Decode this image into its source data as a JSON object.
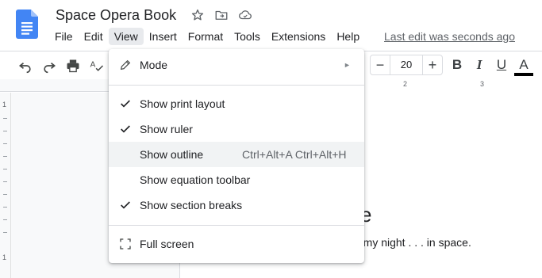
{
  "document": {
    "title": "Space Opera Book",
    "last_edit": "Last edit was seconds ago"
  },
  "menubar": {
    "items": [
      "File",
      "Edit",
      "View",
      "Insert",
      "Format",
      "Tools",
      "Extensions",
      "Help"
    ],
    "active": "View"
  },
  "toolbar": {
    "font_size": "20",
    "minus_label": "−",
    "plus_label": "+",
    "bold_label": "B",
    "italic_label": "I",
    "underline_label": "U",
    "text_color_label": "A",
    "text_color": "#000000"
  },
  "ruler": {
    "horizontal_marks": [
      "2",
      "3"
    ],
    "vertical_marks": [
      "1",
      "1"
    ]
  },
  "view_menu": {
    "mode": {
      "label": "Mode",
      "icon": "pencil-icon"
    },
    "items": [
      {
        "label": "Show print layout",
        "checked": true
      },
      {
        "label": "Show ruler",
        "checked": true
      },
      {
        "label": "Show outline",
        "checked": false,
        "shortcut": "Ctrl+Alt+A Ctrl+Alt+H"
      },
      {
        "label": "Show equation toolbar",
        "checked": false
      },
      {
        "label": "Show section breaks",
        "checked": true
      }
    ],
    "full_screen": {
      "label": "Full screen",
      "icon": "fullscreen-icon"
    }
  },
  "page": {
    "heading_fragment": "e",
    "body_fragment": "rmy night . . . in space."
  },
  "colors": {
    "docs_blue": "#4285f4",
    "menu_hover": "#f1f3f4",
    "active_menu_bg": "#e8eaed"
  }
}
